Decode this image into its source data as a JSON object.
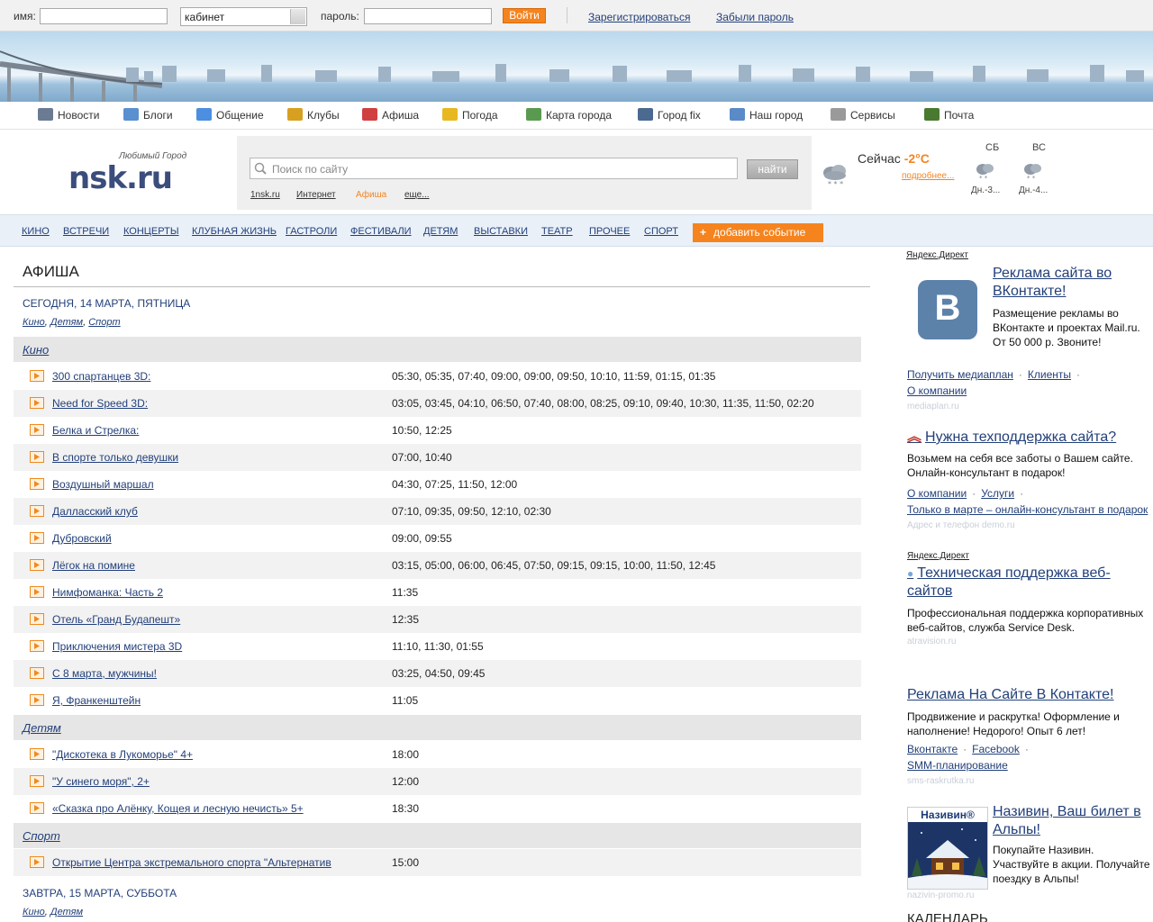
{
  "login": {
    "name_label": "имя:",
    "name_value": "",
    "cabinet_value": "кабинет",
    "password_label": "пароль:",
    "password_value": "",
    "submit": "Войти",
    "register": "Зарегистрироваться",
    "forgot": "Забыли пароль"
  },
  "nav": {
    "items": [
      {
        "label": "Новости",
        "icon": "newspaper-icon",
        "color": "#6b7b93"
      },
      {
        "label": "Блоги",
        "icon": "notepad-icon",
        "color": "#5a8fd0"
      },
      {
        "label": "Общение",
        "icon": "chat-icon",
        "color": "#4c8ee0"
      },
      {
        "label": "Клубы",
        "icon": "cocktail-icon",
        "color": "#d8a020"
      },
      {
        "label": "Афиша",
        "icon": "megaphone-icon",
        "color": "#d04040"
      },
      {
        "label": "Погода",
        "icon": "sun-cloud-icon",
        "color": "#e8b820"
      },
      {
        "label": "Карта города",
        "icon": "map-icon",
        "color": "#5a9a50"
      },
      {
        "label": "Город fix",
        "icon": "tools-icon",
        "color": "#4a6a90"
      },
      {
        "label": "Наш город",
        "icon": "city-icon",
        "color": "#5a8ac8"
      },
      {
        "label": "Сервисы",
        "icon": "bell-icon",
        "color": "#9a9a9a"
      },
      {
        "label": "Почта",
        "icon": "book-icon",
        "color": "#4a7a30"
      }
    ]
  },
  "header": {
    "slogan": "Любимый Город",
    "logo": "nsk.ru",
    "search_placeholder": "Поиск по сайту",
    "search_button": "найти",
    "scopes": [
      "1nsk.ru",
      "Интернет",
      "Афиша",
      "еще..."
    ],
    "active_scope_color": "#f5841f"
  },
  "weather": {
    "now_label": "Сейчас",
    "now_temp": "-2°C",
    "more": "подробнее...",
    "days": [
      {
        "name": "СБ",
        "value": "Дн.-3..."
      },
      {
        "name": "ВС",
        "value": "Дн.-4..."
      }
    ]
  },
  "categories": {
    "items": [
      "КИНО",
      "ВСТРЕЧИ",
      "КОНЦЕРТЫ",
      "КЛУБНАЯ ЖИЗНЬ",
      "ГАСТРОЛИ",
      "ФЕСТИВАЛИ",
      "ДЕТЯМ",
      "ВЫСТАВКИ",
      "ТЕАТР",
      "ПРОЧЕЕ",
      "СПОРТ"
    ],
    "add_event": "добавить событие"
  },
  "afisha": {
    "title": "АФИША",
    "today": {
      "heading": "СЕГОДНЯ, 14 МАРТА, ПЯТНИЦА",
      "tags": [
        "Кино",
        "Детям",
        "Спорт"
      ],
      "groups": [
        {
          "name": "Кино",
          "rows": [
            {
              "title": "300 спартанцев 3D:",
              "times": "05:30, 05:35, 07:40, 09:00, 09:00, 09:50, 10:10, 11:59, 01:15, 01:35"
            },
            {
              "title": "Need for Speed 3D:",
              "times": "03:05, 03:45, 04:10, 06:50, 07:40, 08:00, 08:25, 09:10, 09:40, 10:30, 11:35, 11:50, 02:20"
            },
            {
              "title": "Белка и Стрелка:",
              "times": "10:50, 12:25"
            },
            {
              "title": "В спорте только девушки",
              "times": "07:00, 10:40"
            },
            {
              "title": "Воздушный маршал",
              "times": "04:30, 07:25, 11:50, 12:00"
            },
            {
              "title": "Далласский клуб",
              "times": "07:10, 09:35, 09:50, 12:10, 02:30"
            },
            {
              "title": "Дубровский",
              "times": "09:00, 09:55"
            },
            {
              "title": "Лёгок на помине",
              "times": "03:15, 05:00, 06:00, 06:45, 07:50, 09:15, 09:15, 10:00, 11:50, 12:45"
            },
            {
              "title": "Нимфоманка: Часть 2",
              "times": "11:35"
            },
            {
              "title": "Отель «Гранд Будапешт»",
              "times": "12:35"
            },
            {
              "title": "Приключения мистера 3D",
              "times": "11:10, 11:30, 01:55"
            },
            {
              "title": "С 8 марта, мужчины!",
              "times": "03:25, 04:50, 09:45"
            },
            {
              "title": "Я, Франкенштейн",
              "times": "11:05"
            }
          ]
        },
        {
          "name": "Детям",
          "rows": [
            {
              "title": "\"Дискотека в Лукоморье\" 4+",
              "times": "18:00"
            },
            {
              "title": "\"У синего моря\", 2+",
              "times": "12:00"
            },
            {
              "title": "«Сказка про Алёнку, Кощея и лесную нечисть» 5+",
              "times": "18:30"
            }
          ]
        },
        {
          "name": "Спорт",
          "rows": [
            {
              "title": "Открытие Центра экстремального спорта \"Альтернатив",
              "times": "15:00"
            }
          ]
        }
      ]
    },
    "tomorrow": {
      "heading": "ЗАВТРА, 15 МАРТА, СУББОТА",
      "tags": [
        "Кино",
        "Детям"
      ]
    }
  },
  "sidebar": {
    "ad1": {
      "source": "Яндекс.Директ",
      "title": "Реклама сайта во ВКонтакте!",
      "logo_letter": "В",
      "text": "Размещение рекламы во ВКонтакте и проектах Mail.ru. От 50 000 р. Звоните!",
      "links": [
        "Получить медиаплан",
        "Клиенты",
        "О компании"
      ],
      "domain": "mediaplan.ru"
    },
    "ad2": {
      "title": "Нужна техподдержка сайта?",
      "text": "Возьмем на себя все заботы о Вашем сайте. Онлайн-консультант в подарок!",
      "links": [
        "О компании",
        "Услуги"
      ],
      "link_long": "Только в марте – онлайн-консультант в подарок",
      "domain": "Адрес и телефон  demo.ru"
    },
    "ad3": {
      "source": "Яндекс.Директ",
      "title": "Техническая поддержка веб-сайтов",
      "text": "Профессиональная поддержка корпоративных веб-сайтов, служба Service Desk.",
      "domain": "atravision.ru"
    },
    "ad4": {
      "title": "Реклама На Сайте В Контакте!",
      "text": "Продвижение и раскрутка! Оформление и наполнение! Недорого! Опыт 6 лет!",
      "links": [
        "Вконтакте",
        "Facebook"
      ],
      "link_long": "SMM-планирование",
      "domain": "sms-raskrutka.ru"
    },
    "ad5": {
      "brand": "Називин®",
      "title": "Називин, Ваш билет в Альпы!",
      "text": "Покупайте Називин. Участвуйте в акции. Получайте поездку в Альпы!",
      "domain": "nazivin-promo.ru"
    },
    "calendar_title": "КАЛЕНДАРЬ"
  }
}
